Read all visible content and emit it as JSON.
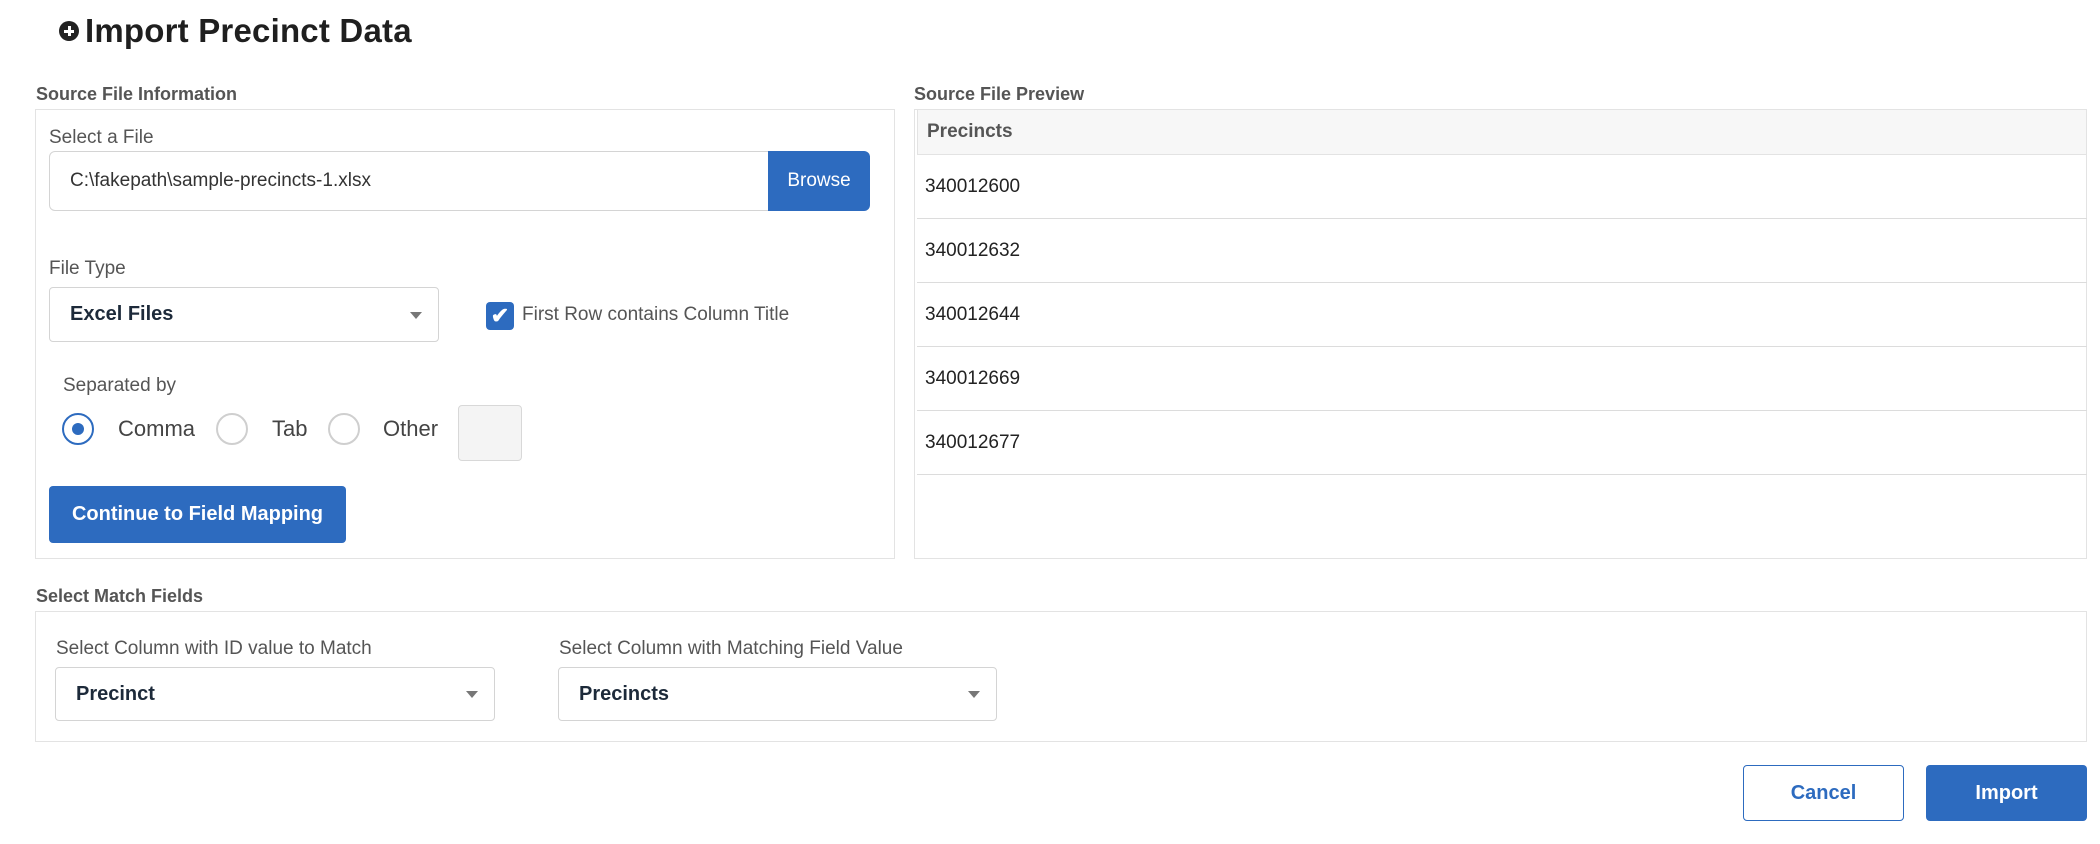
{
  "header": {
    "title": "Import Precinct Data",
    "icon": "plus-circle-icon"
  },
  "source_info": {
    "section_label": "Source File Information",
    "select_file_label": "Select a File",
    "file_path": "C:\\fakepath\\sample-precincts-1.xlsx",
    "browse_label": "Browse",
    "file_type_label": "File Type",
    "file_type_value": "Excel Files",
    "first_row_label": "First Row contains Column Title",
    "first_row_checked": true,
    "separated_by_label": "Separated by",
    "separators": [
      {
        "label": "Comma",
        "checked": true
      },
      {
        "label": "Tab",
        "checked": false
      },
      {
        "label": "Other",
        "checked": false
      }
    ],
    "other_value": "",
    "continue_label": "Continue to Field Mapping"
  },
  "preview": {
    "section_label": "Source File Preview",
    "column_header": "Precincts",
    "rows": [
      "340012600",
      "340012632",
      "340012644",
      "340012669",
      "340012677"
    ]
  },
  "match_fields": {
    "section_label": "Select Match Fields",
    "id_column_label": "Select Column with ID value to Match",
    "id_column_value": "Precinct",
    "matching_column_label": "Select Column with Matching Field Value",
    "matching_column_value": "Precincts"
  },
  "actions": {
    "cancel_label": "Cancel",
    "import_label": "Import"
  },
  "colors": {
    "accent": "#2d6bbf"
  }
}
